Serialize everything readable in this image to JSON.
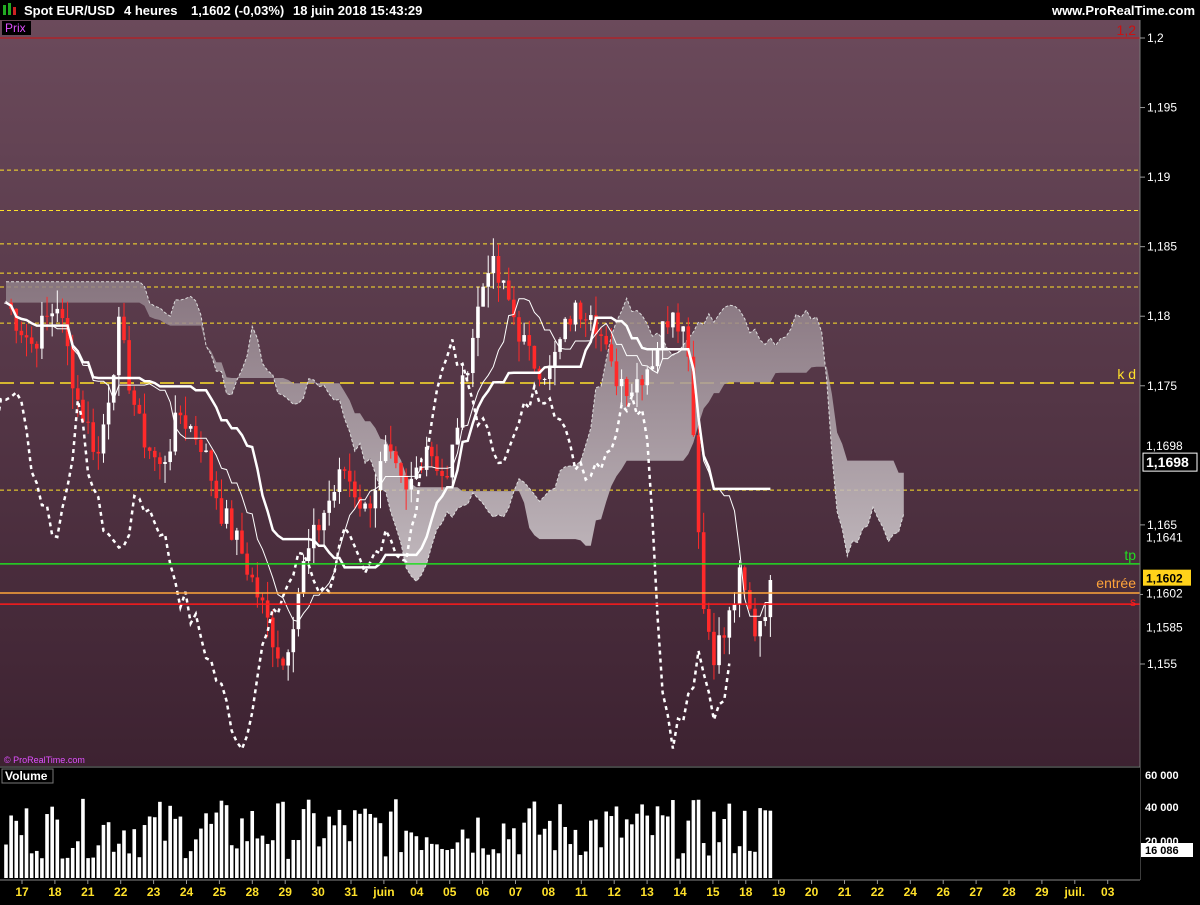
{
  "header": {
    "symbol": "Spot EUR/USD",
    "timeframe": "4 heures",
    "last": "1,1602 (-0,03%)",
    "datetime": "18 juin 2018 15:43:29",
    "site": "www.ProRealTime.com"
  },
  "price_panel": {
    "tag": "Prix",
    "watermark": "© ProRealTime.com",
    "top_line_label": "1,2"
  },
  "volume_panel": {
    "tag": "Volume",
    "ticks": [
      "60 000",
      "40 000",
      "20 000"
    ],
    "current": "16 086"
  },
  "colors": {
    "bg_top": "#6b4a5b",
    "bg_bottom": "#3d2231",
    "up": "#ffffff",
    "down": "#ff2a2a",
    "level": "#ffe12a",
    "tp": "#22dd22",
    "entry": "#ffa43a",
    "stop": "#ff1a1a",
    "top_line": "#cc1111"
  },
  "chart_data": {
    "type": "candlestick",
    "instrument": "Spot EUR/USD",
    "ylim": [
      1.151,
      1.2
    ],
    "price_ticks": [
      {
        "v": 1.2,
        "label": "1,2"
      },
      {
        "v": 1.195,
        "label": "1,195"
      },
      {
        "v": 1.19,
        "label": "1,19"
      },
      {
        "v": 1.185,
        "label": "1,185"
      },
      {
        "v": 1.18,
        "label": "1,18"
      },
      {
        "v": 1.175,
        "label": "1,175"
      },
      {
        "v": 1.165,
        "label": "1,165"
      },
      {
        "v": 1.16,
        "label": "1,16"
      },
      {
        "v": 1.155,
        "label": "1,155"
      }
    ],
    "price_flags": [
      {
        "v": 1.1698,
        "label": "1,1698",
        "style": "plain"
      },
      {
        "v": 1.1698,
        "label": "1,1698",
        "style": "box"
      },
      {
        "v": 1.1641,
        "label": "1,1641",
        "style": "plain"
      },
      {
        "v": 1.1602,
        "label": "1,1602",
        "style": "last"
      },
      {
        "v": 1.1602,
        "label": "1,1602",
        "style": "plain"
      },
      {
        "v": 1.1585,
        "label": "1,1585",
        "style": "plain"
      }
    ],
    "level_lines": [
      1.1905,
      1.1876,
      1.1852,
      1.1831,
      1.1821,
      1.1795,
      1.1675
    ],
    "kd_line": {
      "v": 1.1752,
      "label": "k d"
    },
    "tp_line": {
      "v": 1.1622,
      "label": "tp"
    },
    "entry_line": {
      "v": 1.1601,
      "label": "entrée"
    },
    "stop_line": {
      "v": 1.1593,
      "label": "s"
    },
    "date_labels": [
      "17",
      "18",
      "21",
      "22",
      "23",
      "24",
      "25",
      "28",
      "29",
      "30",
      "31",
      "juin",
      "04",
      "05",
      "06",
      "07",
      "08",
      "11",
      "12",
      "13",
      "14",
      "15",
      "18",
      "19",
      "20",
      "21",
      "22",
      "24",
      "26",
      "27",
      "28",
      "29",
      "juil.",
      "03"
    ],
    "candle_anchors": [
      [
        0,
        1.181
      ],
      [
        5,
        1.178
      ],
      [
        10,
        1.181
      ],
      [
        14,
        1.174
      ],
      [
        18,
        1.17
      ],
      [
        22,
        1.179
      ],
      [
        26,
        1.172
      ],
      [
        30,
        1.169
      ],
      [
        34,
        1.173
      ],
      [
        38,
        1.171
      ],
      [
        42,
        1.166
      ],
      [
        46,
        1.163
      ],
      [
        50,
        1.159
      ],
      [
        54,
        1.155
      ],
      [
        58,
        1.162
      ],
      [
        62,
        1.166
      ],
      [
        66,
        1.169
      ],
      [
        70,
        1.166
      ],
      [
        74,
        1.17
      ],
      [
        78,
        1.167
      ],
      [
        82,
        1.171
      ],
      [
        86,
        1.168
      ],
      [
        90,
        1.177
      ],
      [
        94,
        1.184
      ],
      [
        98,
        1.181
      ],
      [
        102,
        1.177
      ],
      [
        106,
        1.176
      ],
      [
        110,
        1.18
      ],
      [
        114,
        1.181
      ],
      [
        118,
        1.176
      ],
      [
        122,
        1.175
      ],
      [
        126,
        1.177
      ],
      [
        130,
        1.181
      ],
      [
        133,
        1.178
      ],
      [
        136,
        1.159
      ],
      [
        138,
        1.156
      ],
      [
        140,
        1.157
      ],
      [
        143,
        1.161
      ],
      [
        146,
        1.1575
      ],
      [
        149,
        1.1602
      ]
    ],
    "volume_max": 65000
  }
}
